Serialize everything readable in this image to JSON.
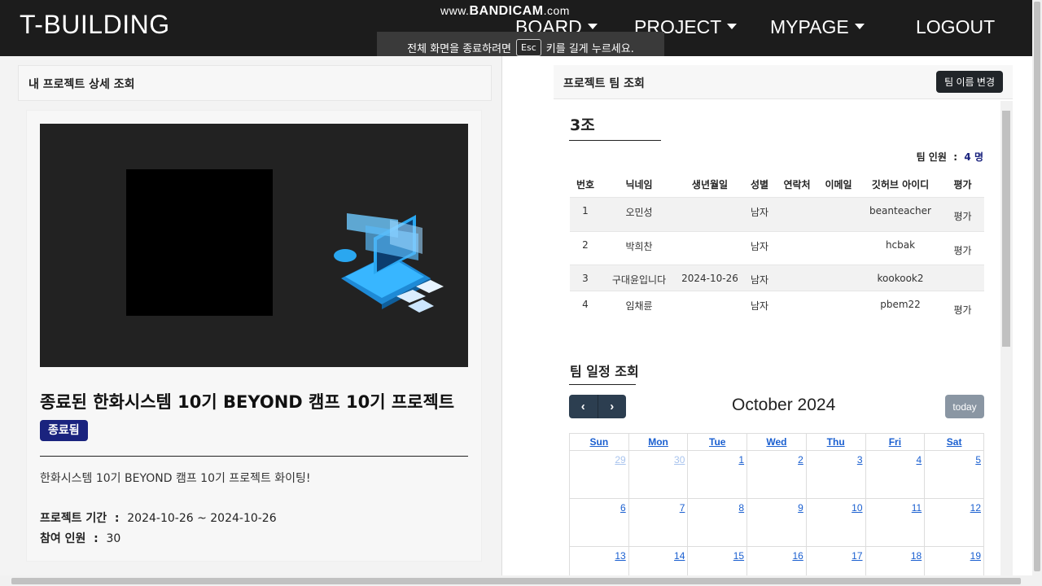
{
  "nav": {
    "brand": "T-BUILDING",
    "items": [
      "BOARD",
      "PROJECT",
      "MYPAGE"
    ],
    "logout": "LOGOUT"
  },
  "overlay": {
    "watermark_small": "www.",
    "watermark_bold": "BANDICAM",
    "watermark_suffix": ".com",
    "fs_before": "전체 화면을 종료하려면",
    "fs_key": "Esc",
    "fs_after": "키를 길게 누르세요."
  },
  "project": {
    "header": "내 프로젝트 상세 조회",
    "title": "종료된 한화시스템 10기 BEYOND 캠프 10기 프로젝트",
    "status": "종료됨",
    "description": "한화시스템 10기 BEYOND 캠프 10기 프로젝트 화이팅!",
    "period_label": "프로젝트 기간",
    "period_value": "2024-10-26 ~ 2024-10-26",
    "members_label": "참여 인원",
    "members_value": "30",
    "colors": {
      "status_badge": "#1a237e"
    }
  },
  "team": {
    "header": "프로젝트 팀 조회",
    "rename_button": "팀 이름 변경",
    "name": "3조",
    "count_label": "팀 인원",
    "count_value": "4 명",
    "columns": [
      "번호",
      "닉네임",
      "생년월일",
      "성별",
      "연락처",
      "이메일",
      "깃허브 아이디",
      "평가"
    ],
    "rows": [
      {
        "no": "1",
        "nickname": "오민성",
        "birth": "",
        "gender": "남자",
        "phone": "",
        "email": "",
        "github": "beanteacher",
        "eval": "평가"
      },
      {
        "no": "2",
        "nickname": "박희찬",
        "birth": "",
        "gender": "남자",
        "phone": "",
        "email": "",
        "github": "hcbak",
        "eval": "평가"
      },
      {
        "no": "3",
        "nickname": "구대윤입니다",
        "birth": "2024-10-26",
        "gender": "남자",
        "phone": "",
        "email": "",
        "github": "kookook2",
        "eval": ""
      },
      {
        "no": "4",
        "nickname": "임채륜",
        "birth": "",
        "gender": "남자",
        "phone": "",
        "email": "",
        "github": "pbem22",
        "eval": "평가"
      }
    ]
  },
  "schedule": {
    "title": "팀 일정 조회",
    "month": "October 2024",
    "prev_icon": "chevron-left-icon",
    "next_icon": "chevron-right-icon",
    "today_button": "today",
    "weekdays": [
      "Sun",
      "Mon",
      "Tue",
      "Wed",
      "Thu",
      "Fri",
      "Sat"
    ],
    "weeks": [
      [
        "29",
        "30",
        "1",
        "2",
        "3",
        "4",
        "5"
      ],
      [
        "6",
        "7",
        "8",
        "9",
        "10",
        "11",
        "12"
      ],
      [
        "13",
        "14",
        "15",
        "16",
        "17",
        "18",
        "19"
      ]
    ],
    "colors": {
      "nav_buttons": "#2c3e50",
      "today_button": "#8a96a3",
      "day_link": "#1a5fd0"
    }
  }
}
